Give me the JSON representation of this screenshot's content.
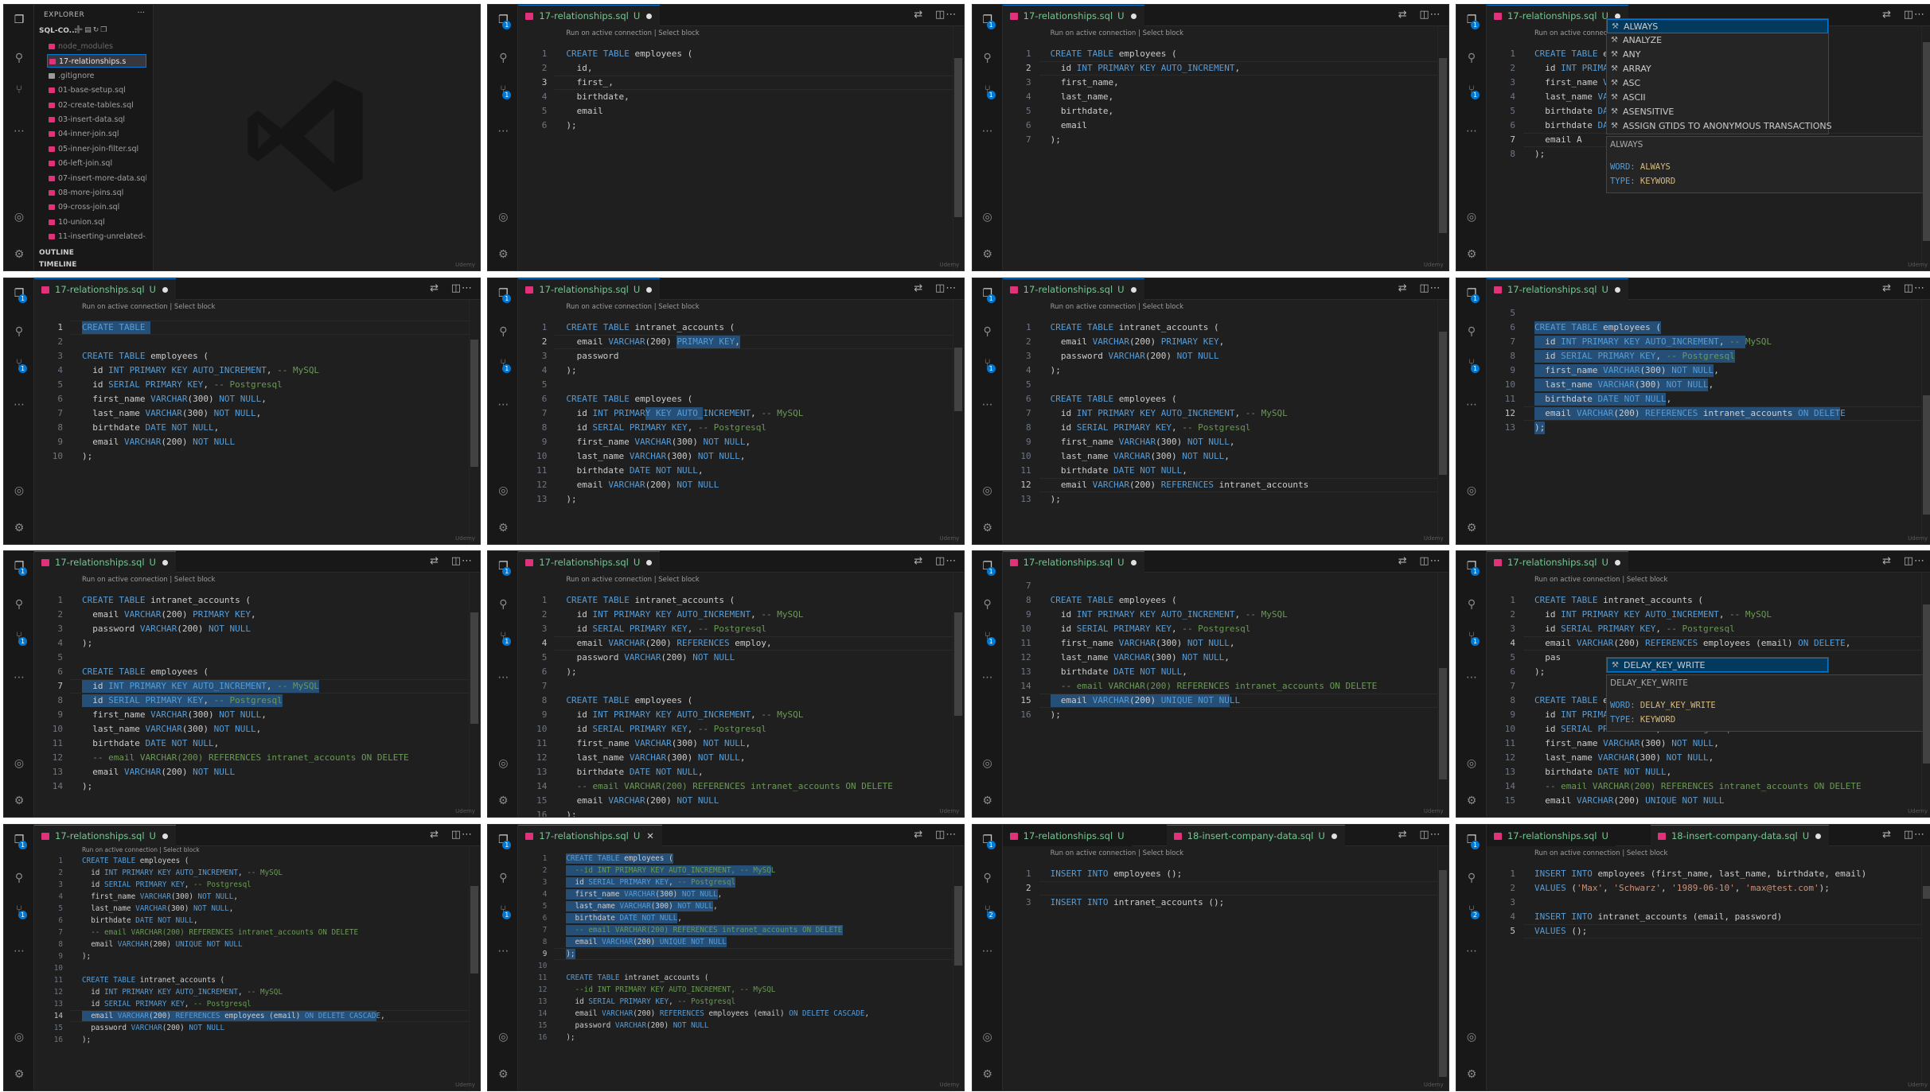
{
  "explorer": {
    "header": "EXPLORER",
    "dots": "···",
    "folder": "SQL-CO...",
    "files": [
      {
        "name": "node_modules",
        "kind": "dim"
      },
      {
        "name": "17-relationships.s",
        "kind": "selected"
      },
      {
        "name": ".gitignore",
        "kind": "git"
      },
      {
        "name": "01-base-setup.sql",
        "kind": "sql"
      },
      {
        "name": "02-create-tables.sql",
        "kind": "sql"
      },
      {
        "name": "03-insert-data.sql",
        "kind": "sql"
      },
      {
        "name": "04-inner-join.sql",
        "kind": "sql"
      },
      {
        "name": "05-inner-join-filter.sql",
        "kind": "sql"
      },
      {
        "name": "06-left-join.sql",
        "kind": "sql"
      },
      {
        "name": "07-insert-more-data.sql",
        "kind": "sql"
      },
      {
        "name": "08-more-joins.sql",
        "kind": "sql"
      },
      {
        "name": "09-cross-join.sql",
        "kind": "sql"
      },
      {
        "name": "10-union.sql",
        "kind": "sql"
      },
      {
        "name": "11-inserting-unrelated-...",
        "kind": "sql"
      }
    ],
    "outline": "OUTLINE",
    "timeline": "TIMELINE"
  },
  "watermark": "Udemy",
  "icons": {
    "explorer": "files-icon",
    "search": "search-icon",
    "scm": "source-control-icon",
    "db": "database-icon",
    "more": "more-icon",
    "account": "account-icon",
    "settings": "gear-icon",
    "compare": "compare-icon",
    "split": "split-editor-icon"
  },
  "colors": {
    "bg": "#1f1f1f",
    "keyword": "#569cd6",
    "comment": "#6a9955",
    "string": "#ce9178",
    "selection": "#264f78",
    "tab_text": "#73c991",
    "accent": "#0078d4"
  },
  "codelens": "Run on active connection | Select block",
  "tiles": [
    {
      "type": "explorer"
    },
    {
      "tabs": [
        {
          "label": "17-relationships.sql",
          "flag": "U",
          "dirty": true
        }
      ],
      "codelens": true,
      "start": 1,
      "cursor": 3,
      "lines": [
        "CREATE TABLE employees (",
        "  id,",
        "  first_,",
        "  birthdate,",
        "  email",
        ");"
      ]
    },
    {
      "tabs": [
        {
          "label": "17-relationships.sql",
          "flag": "U",
          "dirty": true
        }
      ],
      "codelens": true,
      "start": 1,
      "cursor": 2,
      "lines": [
        "CREATE TABLE employees (",
        "  id INT PRIMARY KEY AUTO_INCREMENT,",
        "  first_name,",
        "  last_name,",
        "  birthdate,",
        "  email",
        ");"
      ]
    },
    {
      "tabs": [
        {
          "label": "17-relationships.sql",
          "flag": "U",
          "dirty": true
        }
      ],
      "codelens": true,
      "start": 1,
      "cursor": 7,
      "lines": [
        "CREATE TABLE employees (",
        "  id INT PRIMARY KEY AUTO_INCREMENT,",
        "  first_name VARCHAR(300) NOT NULL,",
        "  last_name VARCHAR(300) NOT NULL,",
        "  birthdate DATE NOT NULL,",
        "  birthdate DATE NOT NULL,",
        "  email A",
        ");"
      ],
      "ac_items": [
        "ALWAYS",
        "ANALYZE",
        "ANY",
        "ARRAY",
        "ASC",
        "ASCII",
        "ASENSITIVE",
        "ASSIGN GTIDS TO ANONYMOUS TRANSACTIONS"
      ],
      "ac_detail": {
        "title": "ALWAYS",
        "word_label": "WORD:",
        "word": "ALWAYS",
        "type_label": "TYPE:",
        "type": "KEYWORD"
      }
    },
    {
      "tabs": [
        {
          "label": "17-relationships.sql",
          "flag": "U",
          "dirty": true
        }
      ],
      "codelens": true,
      "start": 1,
      "cursor": 1,
      "lines": [
        "CREATE TABLE ",
        "",
        "CREATE TABLE employees (",
        "  id INT PRIMARY KEY AUTO_INCREMENT, -- MySQL",
        "  id SERIAL PRIMARY KEY, -- Postgresql",
        "  first_name VARCHAR(300) NOT NULL,",
        "  last_name VARCHAR(300) NOT NULL,",
        "  birthdate DATE NOT NULL,",
        "  email VARCHAR(200) NOT NULL",
        ");"
      ]
    },
    {
      "tabs": [
        {
          "label": "17-relationships.sql",
          "flag": "U",
          "dirty": true
        }
      ],
      "codelens": true,
      "start": 1,
      "cursor": 2,
      "lines": [
        "CREATE TABLE intranet_accounts (",
        "  email VARCHAR(200) PRIMARY KEY,",
        "  password",
        ");",
        "",
        "CREATE TABLE employees (",
        "  id INT PRIMARY KEY AUTO_INCREMENT, -- MySQL",
        "  id SERIAL PRIMARY KEY, -- Postgresql",
        "  first_name VARCHAR(300) NOT NULL,",
        "  last_name VARCHAR(300) NOT NULL,",
        "  birthdate DATE NOT NULL,",
        "  email VARCHAR(200) NOT NULL",
        ");"
      ]
    },
    {
      "tabs": [
        {
          "label": "17-relationships.sql",
          "flag": "U",
          "dirty": true
        }
      ],
      "codelens": true,
      "start": 1,
      "cursor": 12,
      "lines": [
        "CREATE TABLE intranet_accounts (",
        "  email VARCHAR(200) PRIMARY KEY,",
        "  password VARCHAR(200) NOT NULL",
        ");",
        "",
        "CREATE TABLE employees (",
        "  id INT PRIMARY KEY AUTO_INCREMENT, -- MySQL",
        "  id SERIAL PRIMARY KEY, -- Postgresql",
        "  first_name VARCHAR(300) NOT NULL,",
        "  last_name VARCHAR(300) NOT NULL,",
        "  birthdate DATE NOT NULL,",
        "  email VARCHAR(200) REFERENCES intranet_accounts",
        ");"
      ]
    },
    {
      "tabs": [
        {
          "label": "17-relationships.sql",
          "flag": "U",
          "dirty": true
        }
      ],
      "codelens": false,
      "start": 5,
      "cursor": 12,
      "lines": [
        "",
        "CREATE TABLE employees (",
        "  id INT PRIMARY KEY AUTO_INCREMENT, -- MySQL",
        "  id SERIAL PRIMARY KEY, -- Postgresql",
        "  first_name VARCHAR(300) NOT NULL,",
        "  last_name VARCHAR(300) NOT NULL,",
        "  birthdate DATE NOT NULL,",
        "  email VARCHAR(200) REFERENCES intranet_accounts ON DELETE",
        ");"
      ]
    },
    {
      "tabs": [
        {
          "label": "17-relationships.sql",
          "flag": "U",
          "dirty": true
        }
      ],
      "codelens": true,
      "start": 1,
      "cursor": 7,
      "lines": [
        "CREATE TABLE intranet_accounts (",
        "  email VARCHAR(200) PRIMARY KEY,",
        "  password VARCHAR(200) NOT NULL",
        ");",
        "",
        "CREATE TABLE employees (",
        "  id INT PRIMARY KEY AUTO_INCREMENT, -- MySQL",
        "  id SERIAL PRIMARY KEY, -- Postgresql",
        "  first_name VARCHAR(300) NOT NULL,",
        "  last_name VARCHAR(300) NOT NULL,",
        "  birthdate DATE NOT NULL,",
        "  -- email VARCHAR(200) REFERENCES intranet_accounts ON DELETE",
        "  email VARCHAR(200) NOT NULL",
        ");"
      ]
    },
    {
      "tabs": [
        {
          "label": "17-relationships.sql",
          "flag": "U",
          "dirty": true
        }
      ],
      "codelens": true,
      "start": 1,
      "cursor": 4,
      "lines": [
        "CREATE TABLE intranet_accounts (",
        "  id INT PRIMARY KEY AUTO_INCREMENT, -- MySQL",
        "  id SERIAL PRIMARY KEY, -- Postgresql",
        "  email VARCHAR(200) REFERENCES employ,",
        "  password VARCHAR(200) NOT NULL",
        ");",
        "",
        "CREATE TABLE employees (",
        "  id INT PRIMARY KEY AUTO_INCREMENT, -- MySQL",
        "  id SERIAL PRIMARY KEY, -- Postgresql",
        "  first_name VARCHAR(300) NOT NULL,",
        "  last_name VARCHAR(300) NOT NULL,",
        "  birthdate DATE NOT NULL,",
        "  -- email VARCHAR(200) REFERENCES intranet_accounts ON DELETE",
        "  email VARCHAR(200) NOT NULL",
        ");"
      ]
    },
    {
      "tabs": [
        {
          "label": "17-relationships.sql",
          "flag": "U",
          "dirty": true
        }
      ],
      "codelens": false,
      "start": 7,
      "cursor": 15,
      "lines": [
        "",
        "CREATE TABLE employees (",
        "  id INT PRIMARY KEY AUTO_INCREMENT, -- MySQL",
        "  id SERIAL PRIMARY KEY, -- Postgresql",
        "  first_name VARCHAR(300) NOT NULL,",
        "  last_name VARCHAR(300) NOT NULL,",
        "  birthdate DATE NOT NULL,",
        "  -- email VARCHAR(200) REFERENCES intranet_accounts ON DELETE",
        "  email VARCHAR(200) UNIQUE NOT NULL",
        ");"
      ]
    },
    {
      "tabs": [
        {
          "label": "17-relationships.sql",
          "flag": "U",
          "dirty": true
        }
      ],
      "codelens": true,
      "start": 1,
      "cursor": 4,
      "lines": [
        "CREATE TABLE intranet_accounts (",
        "  id INT PRIMARY KEY AUTO_INCREMENT, -- MySQL",
        "  id SERIAL PRIMARY KEY, -- Postgresql",
        "  email VARCHAR(200) REFERENCES employees (email) ON DELETE,",
        "  pas",
        ");",
        "",
        "CREATE TABLE employees (",
        "  id INT PRIMARY KEY AUTO_INCREMENT, -- MySQL",
        "  id SERIAL PRIMARY KEY, -- Postgresql",
        "  first_name VARCHAR(300) NOT NULL,",
        "  last_name VARCHAR(300) NOT NULL,",
        "  birthdate DATE NOT NULL,",
        "  -- email VARCHAR(200) REFERENCES intranet_accounts ON DELETE",
        "  email VARCHAR(200) UNIQUE NOT NULL"
      ],
      "ac_items": [
        "DELAY_KEY_WRITE"
      ],
      "ac_detail": {
        "title": "DELAY_KEY_WRITE",
        "word_label": "WORD:",
        "word": "DELAY_KEY_WRITE",
        "type_label": "TYPE:",
        "type": "KEYWORD"
      }
    },
    {
      "tabs": [
        {
          "label": "17-relationships.sql",
          "flag": "U",
          "dirty": true
        }
      ],
      "codelens": true,
      "start": 1,
      "cursor": 14,
      "small": true,
      "lines": [
        "CREATE TABLE employees (",
        "  id INT PRIMARY KEY AUTO_INCREMENT, -- MySQL",
        "  id SERIAL PRIMARY KEY, -- Postgresql",
        "  first_name VARCHAR(300) NOT NULL,",
        "  last_name VARCHAR(300) NOT NULL,",
        "  birthdate DATE NOT NULL,",
        "  -- email VARCHAR(200) REFERENCES intranet_accounts ON DELETE",
        "  email VARCHAR(200) UNIQUE NOT NULL",
        ");",
        "",
        "CREATE TABLE intranet_accounts (",
        "  id INT PRIMARY KEY AUTO_INCREMENT, -- MySQL",
        "  id SERIAL PRIMARY KEY, -- Postgresql",
        "  email VARCHAR(200) REFERENCES employees (email) ON DELETE CASCADE,",
        "  password VARCHAR(200) NOT NULL",
        ");"
      ]
    },
    {
      "tabs": [
        {
          "label": "17-relationships.sql",
          "flag": "U",
          "close": true
        }
      ],
      "codelens": false,
      "start": 1,
      "cursor": 9,
      "small": true,
      "lines": [
        "CREATE TABLE employees (",
        "  --id INT PRIMARY KEY AUTO_INCREMENT, -- MySQL",
        "  id SERIAL PRIMARY KEY, -- Postgresql",
        "  first_name VARCHAR(300) NOT NULL,",
        "  last_name VARCHAR(300) NOT NULL,",
        "  birthdate DATE NOT NULL,",
        "  -- email VARCHAR(200) REFERENCES intranet_accounts ON DELETE",
        "  email VARCHAR(200) UNIQUE NOT NULL",
        ");",
        "",
        "CREATE TABLE intranet_accounts (",
        "  --id INT PRIMARY KEY AUTO_INCREMENT, -- MySQL",
        "  id SERIAL PRIMARY KEY, -- Postgresql",
        "  email VARCHAR(200) REFERENCES employees (email) ON DELETE CASCADE,",
        "  password VARCHAR(200) NOT NULL",
        ");"
      ]
    },
    {
      "tabs": [
        {
          "label": "17-relationships.sql",
          "flag": "U",
          "inactive": true
        },
        {
          "label": "18-insert-company-data.sql",
          "flag": "U",
          "dirty": true
        }
      ],
      "codelens": true,
      "start": 1,
      "cursor": 2,
      "lines": [
        "INSERT INTO employees ();",
        "",
        "INSERT INTO intranet_accounts ();"
      ]
    },
    {
      "tabs": [
        {
          "label": "17-relationships.sql",
          "flag": "U",
          "inactive": true
        },
        {
          "label": "18-insert-company-data.sql",
          "flag": "U",
          "dirty": true
        }
      ],
      "codelens": true,
      "start": 1,
      "cursor": 5,
      "lines": [
        "INSERT INTO employees (first_name, last_name, birthdate, email)",
        "VALUES ('Max', 'Schwarz', '1989-06-10', 'max@test.com');",
        "",
        "INSERT INTO intranet_accounts (email, password)",
        "VALUES ();"
      ]
    }
  ]
}
